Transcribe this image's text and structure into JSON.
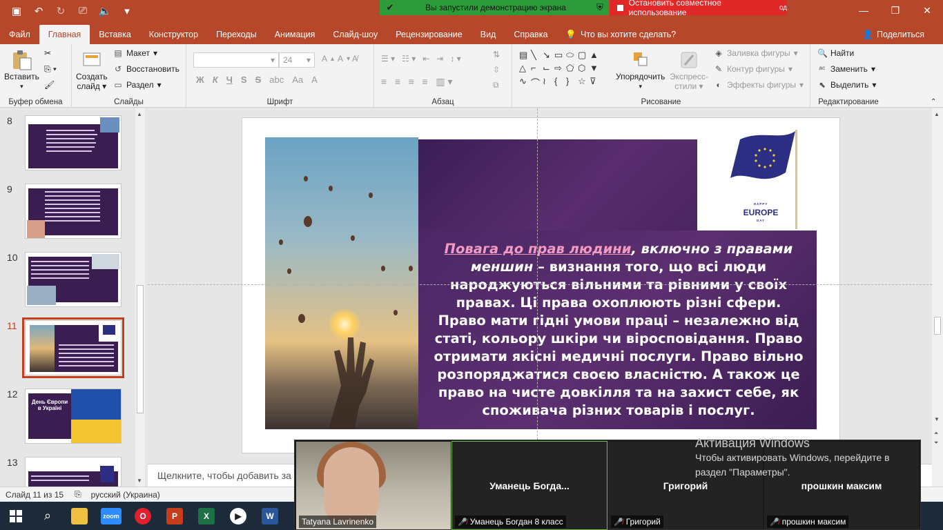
{
  "titlebar": {
    "sharing_banner": "Вы запустили демонстрацию экрана",
    "stop_share": "Остановить совместное использование",
    "stop_share_suffix": "од"
  },
  "tabs": [
    "Файл",
    "Главная",
    "Вставка",
    "Конструктор",
    "Переходы",
    "Анимация",
    "Слайд-шоу",
    "Рецензирование",
    "Вид",
    "Справка"
  ],
  "search_label": "Что вы хотите сделать?",
  "share_label": "Поделиться",
  "ribbon": {
    "clipboard": {
      "paste": "Вставить",
      "label": "Буфер обмена"
    },
    "slides": {
      "new_slide_1": "Создать",
      "new_slide_2": "слайд",
      "layout": "Макет",
      "reset": "Восстановить",
      "section": "Раздел",
      "label": "Слайды"
    },
    "font": {
      "size": "24",
      "label": "Шрифт",
      "bold": "Ж",
      "italic": "К",
      "underline": "Ч",
      "strike": "S",
      "spacing": "abc",
      "case": "Aa",
      "color": "A"
    },
    "paragraph": {
      "label": "Абзац"
    },
    "drawing": {
      "arrange": "Упорядочить",
      "quick_styles_1": "Экспресс-",
      "quick_styles_2": "стили",
      "fill": "Заливка фигуры",
      "outline": "Контур фигуры",
      "effects": "Эффекты фигуры",
      "label": "Рисование"
    },
    "editing": {
      "find": "Найти",
      "replace": "Заменить",
      "select": "Выделить",
      "label": "Редактирование"
    }
  },
  "thumbnails": [
    {
      "num": "8"
    },
    {
      "num": "9"
    },
    {
      "num": "10"
    },
    {
      "num": "11",
      "selected": true
    },
    {
      "num": "12",
      "title": "День Європи в Україні"
    },
    {
      "num": "13"
    }
  ],
  "slide": {
    "europe_small": "HAPPY",
    "europe_big": "EUROPE",
    "europe_day": "DAY",
    "text_pink": "Повага до прав людини",
    "text_italic": ", включно з правами меншин",
    "text_rest": " – визнання того, що всі люди народжуються вільними та рівними у своїх правах. Ці права охоплюють різні сфери. Право мати гідні умови праці – незалежно від статі, кольору шкіри чи віросповідання. Право отримати якісні медичні послуги. Право вільно розпоряджатися своєю власністю. А також це право на чисте довкілля та на захист себе, як споживача різних товарів і послуг."
  },
  "notes_placeholder": "Щелкните, чтобы добавить за",
  "status": {
    "slide_of": "Слайд 11 из 15",
    "language": "русский (Украина)"
  },
  "zoom": {
    "tiles": [
      {
        "name": "",
        "label": "Tatyana Lavrinenko"
      },
      {
        "name": "Уманець  Богда...",
        "label": "Уманець Богдан 8 класс"
      },
      {
        "name": "Григорий",
        "label": "Григорий"
      },
      {
        "name": "прошкин максим",
        "label": "прошкин максим"
      }
    ]
  },
  "activation": {
    "title": "Активация Windows",
    "line1": "Чтобы активировать Windows, перейдите в",
    "line2": "раздел \"Параметры\"."
  },
  "taskbar": {
    "zoom_label": "zoom"
  },
  "colors": {
    "accent": "#b7472a",
    "slide_purple": "#4b2765",
    "pink": "#f39ac3",
    "share_green": "#2e9b3a",
    "stop_red": "#e02828"
  }
}
